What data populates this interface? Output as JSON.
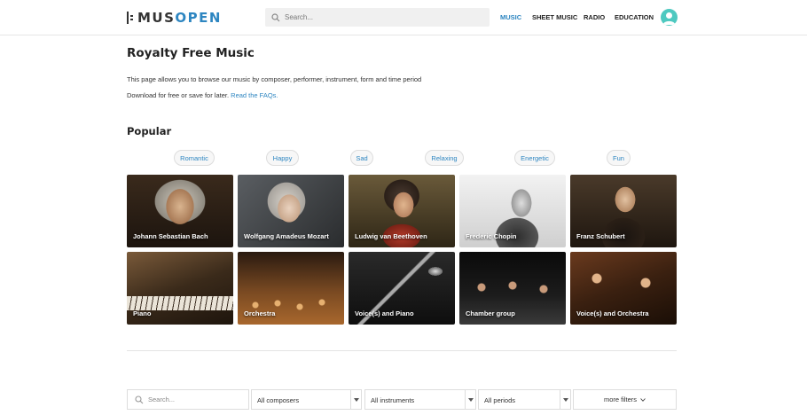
{
  "header": {
    "logo": {
      "part1": "MUS",
      "part2": "OPEN"
    },
    "search_placeholder": "Search...",
    "nav": {
      "music": "MUSIC",
      "sheet_music": "SHEET MUSIC",
      "radio": "RADIO",
      "education": "EDUCATION"
    },
    "accent_color": "#2e86c1"
  },
  "intro": {
    "title": "Royalty Free Music",
    "line1": "This page allows you to browse our music by composer, performer, instrument, form and time period",
    "line2": "Download for free or save for later.",
    "faq_link": "Read the FAQs."
  },
  "popular": {
    "heading": "Popular",
    "moods": [
      "Romantic",
      "Happy",
      "Sad",
      "Relaxing",
      "Energetic",
      "Fun"
    ]
  },
  "composers": [
    {
      "label": "Johann Sebastian Bach"
    },
    {
      "label": "Wolfgang Amadeus Mozart"
    },
    {
      "label": "Ludwig van Beethoven"
    },
    {
      "label": "Frederic Chopin"
    },
    {
      "label": "Franz Schubert"
    }
  ],
  "ensembles": [
    {
      "label": "Piano"
    },
    {
      "label": "Orchestra"
    },
    {
      "label": "Voice(s) and Piano"
    },
    {
      "label": "Chamber group"
    },
    {
      "label": "Voice(s) and Orchestra"
    }
  ],
  "filters": {
    "search_placeholder": "Search...",
    "composers": "All composers",
    "instruments": "All instruments",
    "periods": "All periods",
    "more": "more filters"
  }
}
